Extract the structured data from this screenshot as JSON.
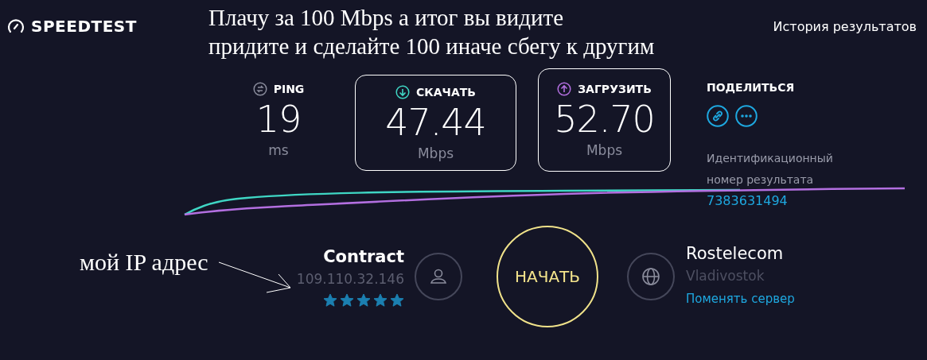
{
  "header": {
    "logo": "SPEEDTEST",
    "history_link": "История результатов"
  },
  "annotation_top": [
    "Плачу за 100 Mbps а итог вы видите",
    "придите и сделайте 100 иначе сбегу к другим"
  ],
  "metrics": [
    {
      "kind": "ping",
      "label": "PING",
      "value": "19",
      "unit": "ms",
      "highlighted": false
    },
    {
      "kind": "download",
      "label": "СКАЧАТЬ",
      "value": "47.44",
      "unit": "Mbps",
      "highlighted": true
    },
    {
      "kind": "upload",
      "label": "ЗАГРУЗИТЬ",
      "value": "52.70",
      "unit": "Mbps",
      "highlighted": true
    }
  ],
  "share": {
    "label": "ПОДЕЛИТЬСЯ",
    "result_id_label": "Идентификационный номер результата",
    "result_id": "7383631494"
  },
  "client": {
    "isp": "Contract",
    "ip": "109.110.32.146",
    "stars": 5
  },
  "start_button": "НАЧАТЬ",
  "server": {
    "name": "Rostelecom",
    "location": "Vladivostok",
    "change_link": "Поменять сервер"
  },
  "annotation_ip": "мой IP адрес"
}
